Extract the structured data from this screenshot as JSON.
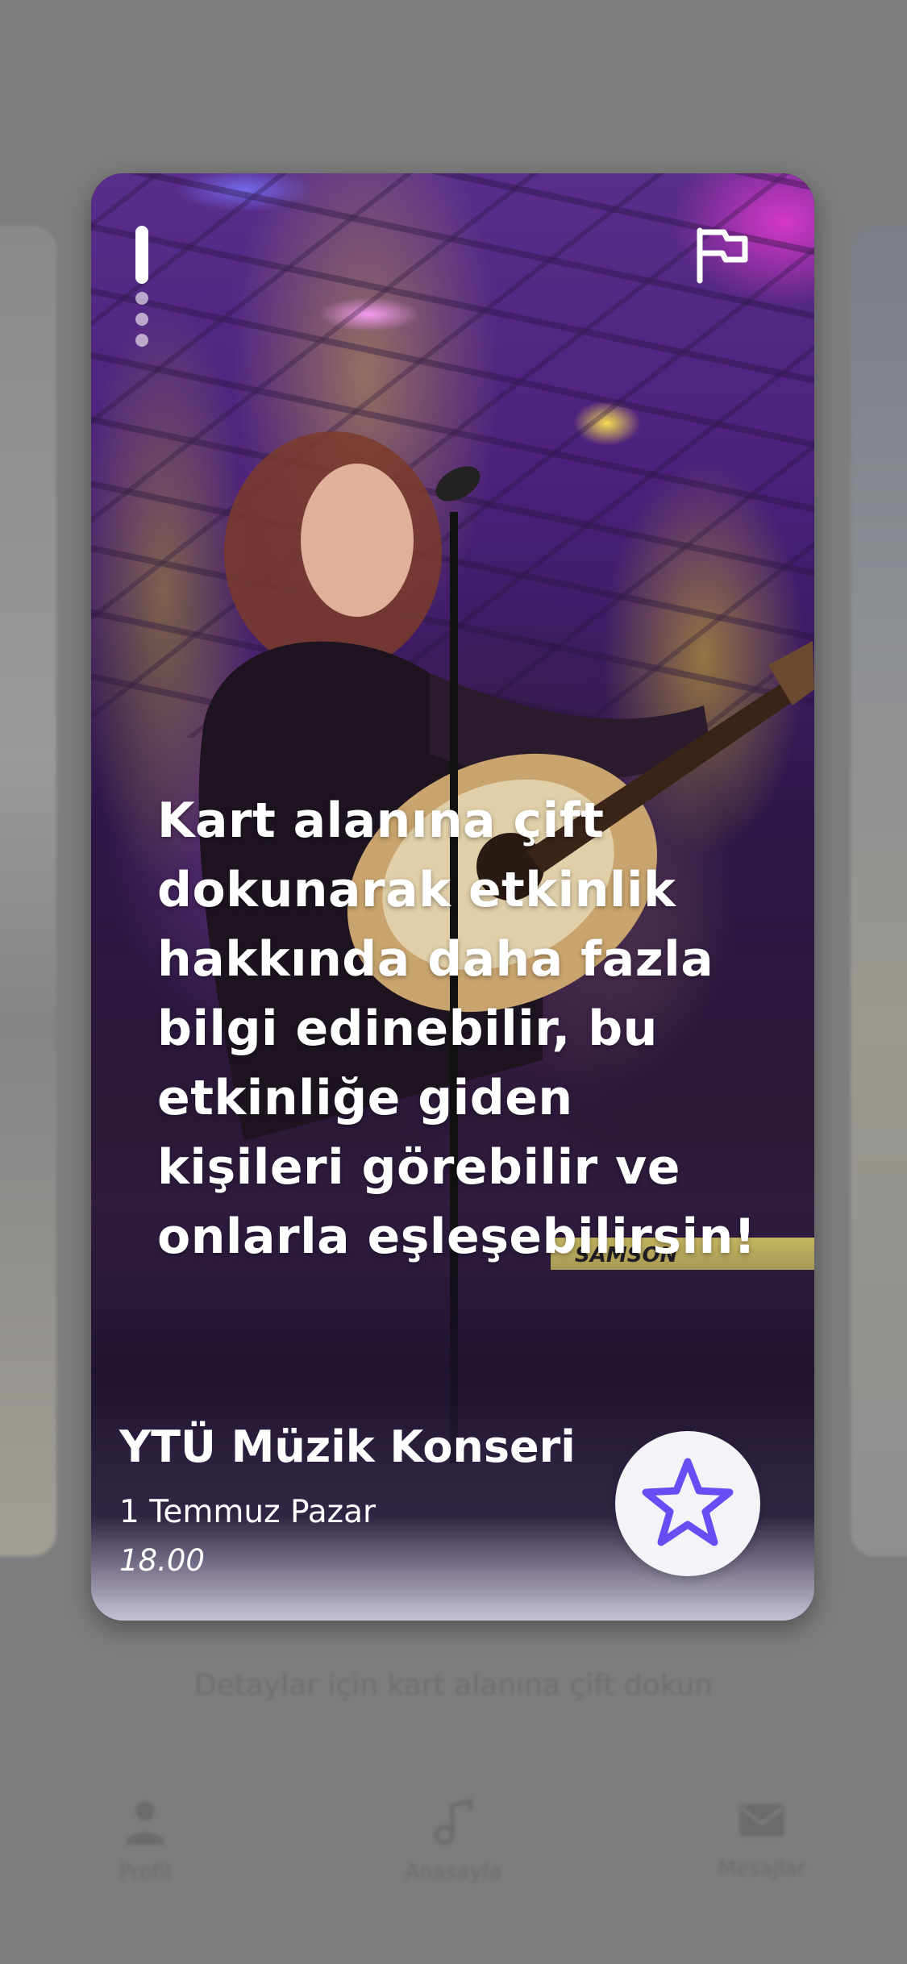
{
  "background": {
    "hint_text": "Detaylar için kart alanına çift dokun",
    "tabs": [
      {
        "label": "Profil",
        "icon": "person-icon"
      },
      {
        "label": "Anasayfa",
        "icon": "music-note-icon"
      },
      {
        "label": "Mesajlar",
        "icon": "mail-icon"
      }
    ]
  },
  "card": {
    "image": "concert-guitarist-photo",
    "progress": {
      "total": 4,
      "active_index": 0
    },
    "report_icon": "flag-icon",
    "overlay_text": "Kart alanına çift dokunarak etkinlik hakkında daha fazla bilgi edinebilir, bu etkinliğe giden kişileri görebilir ve onlarla eşleşebilirsin!",
    "event": {
      "title": "YTÜ Müzik Konseri",
      "date": "1 Temmuz Pazar",
      "time": "18.00"
    },
    "favorite_icon": "star-icon",
    "colors": {
      "accent": "#6a4cf5",
      "overlay_dim": "#7d7d7d",
      "button_bg": "#f4f3f7"
    }
  }
}
